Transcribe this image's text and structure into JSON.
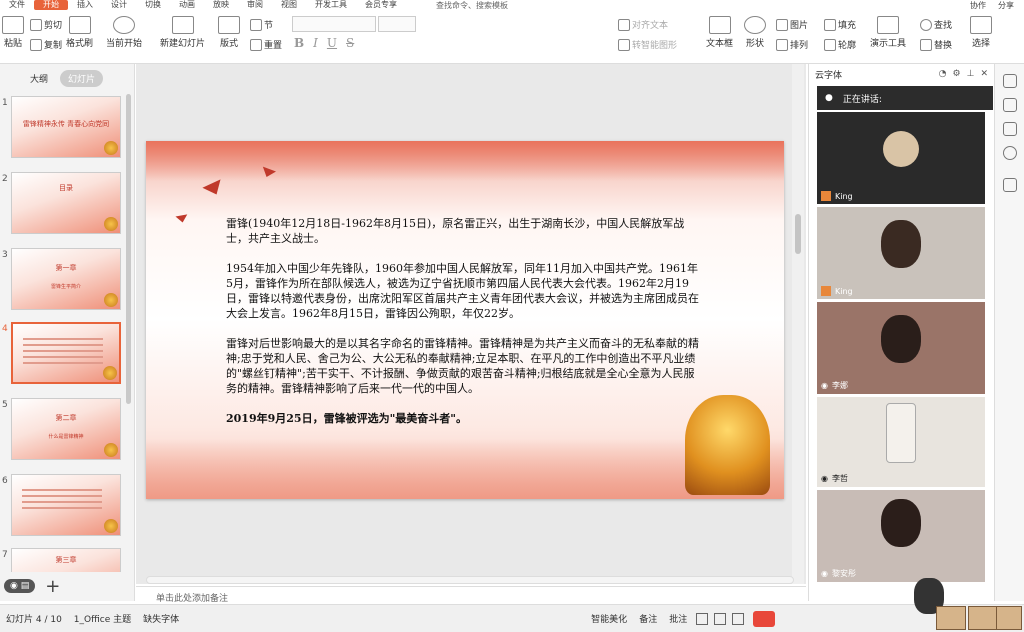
{
  "menubar": {
    "items": [
      "文件",
      "开始",
      "插入",
      "设计",
      "切换",
      "动画",
      "放映",
      "审阅",
      "视图",
      "开发工具",
      "会员专享"
    ],
    "search": "查找命令、搜索模板",
    "right": [
      "协作",
      "分享"
    ]
  },
  "ribbon": {
    "paste": "粘贴",
    "cut": "剪切",
    "copy": "复制",
    "format_painter": "格式刷",
    "from_current": "当前开始",
    "new_slide": "新建幻灯片",
    "layout": "版式",
    "section": "节",
    "reset": "重置",
    "bold": "B",
    "italic": "I",
    "underline": "U",
    "strike": "S",
    "align_text": "对齐文本",
    "convert_smartart": "转智能图形",
    "textbox": "文本框",
    "shape": "形状",
    "picture": "图片",
    "arrange": "排列",
    "fill": "填充",
    "outline": "轮廓",
    "presenter_tools": "演示工具",
    "find": "查找",
    "replace": "替换",
    "select": "选择"
  },
  "leftpanel": {
    "tab_outline": "大纲",
    "tab_slides": "幻灯片",
    "thumbs": [
      {
        "num": "1",
        "title": "雷锋精神永传 青春心向党同",
        "sub": ""
      },
      {
        "num": "2",
        "title": "目录",
        "sub": ""
      },
      {
        "num": "3",
        "title": "第一章",
        "sub": "雷锋生平简介"
      },
      {
        "num": "4",
        "title": "",
        "sub": ""
      },
      {
        "num": "5",
        "title": "第二章",
        "sub": "什么是雷锋精神"
      },
      {
        "num": "6",
        "title": "",
        "sub": ""
      },
      {
        "num": "7",
        "title": "第三章",
        "sub": ""
      }
    ]
  },
  "slide": {
    "p1": "雷锋(1940年12月18日-1962年8月15日)，原名雷正兴，出生于湖南长沙，中国人民解放军战士，共产主义战士。",
    "p2": "1954年加入中国少年先锋队，1960年参加中国人民解放军，同年11月加入中国共产党。1961年5月，雷锋作为所在部队候选人，被选为辽宁省抚顺市第四届人民代表大会代表。1962年2月19日，雷锋以特邀代表身份，出席沈阳军区首届共产主义青年团代表大会议，并被选为主席团成员在大会上发言。1962年8月15日，雷锋因公殉职，年仅22岁。",
    "p3": "雷锋对后世影响最大的是以其名字命名的雷锋精神。雷锋精神是为共产主义而奋斗的无私奉献的精神;忠于党和人民、舍己为公、大公无私的奉献精神;立足本职、在平凡的工作中创造出不平凡业绩的\"螺丝钉精神\";苦干实干、不计报酬、争做贡献的艰苦奋斗精神;归根结底就是全心全意为人民服务的精神。雷锋精神影响了后来一代一代的中国人。",
    "p4": "2019年9月25日，雷锋被评选为\"最美奋斗者\"。"
  },
  "notes": {
    "placeholder": "单击此处添加备注"
  },
  "rpanel": {
    "font_label": "云字体",
    "speaking": "正在讲话:",
    "tiles": [
      {
        "name": "King"
      },
      {
        "name": "King"
      },
      {
        "name": "李娜"
      },
      {
        "name": "李哲"
      },
      {
        "name": "黎安彤"
      }
    ]
  },
  "status": {
    "slide_info": "幻灯片 4 / 10",
    "theme": "1_Office 主题",
    "missing_font": "缺失字体",
    "smart_beautify": "智能美化",
    "notes": "备注",
    "comment": "批注"
  },
  "colors": {
    "accent": "#e8633a",
    "slide_red": "#c0392b"
  }
}
